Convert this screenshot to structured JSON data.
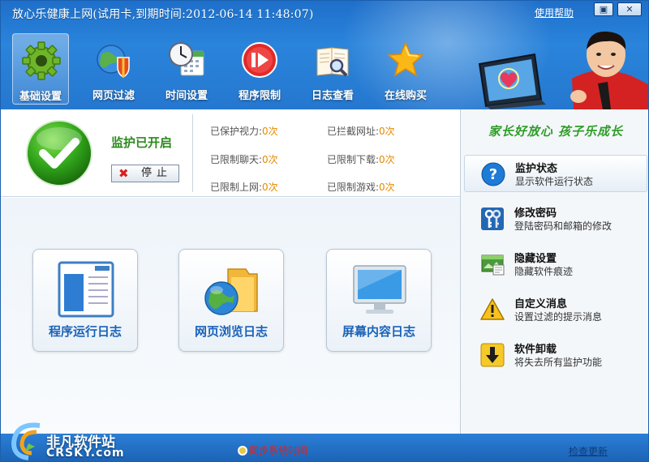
{
  "window": {
    "title": "放心乐健康上网(试用卡,到期时间:2012-06-14 11:48:07)",
    "help": "使用帮助",
    "min_symbol": "▣",
    "close_symbol": "✕"
  },
  "toolbar": [
    {
      "label": "基础设置",
      "icon": "gear-icon",
      "active": true
    },
    {
      "label": "网页过滤",
      "icon": "globe-shield-icon"
    },
    {
      "label": "时间设置",
      "icon": "clock-calendar-icon"
    },
    {
      "label": "程序限制",
      "icon": "stop-program-icon"
    },
    {
      "label": "日志查看",
      "icon": "log-search-icon"
    },
    {
      "label": "在线购买",
      "icon": "star-icon"
    }
  ],
  "status": {
    "title": "监护已开启",
    "stop_label": "停止",
    "stop_symbol": "✖",
    "stats": [
      {
        "label": "已保护视力:",
        "value": "0次"
      },
      {
        "label": "已拦截网址:",
        "value": "0次"
      },
      {
        "label": "已限制聊天:",
        "value": "0次"
      },
      {
        "label": "已限制下载:",
        "value": "0次"
      },
      {
        "label": "已限制上网:",
        "value": "0次"
      },
      {
        "label": "已限制游戏:",
        "value": "0次"
      }
    ]
  },
  "cards": [
    {
      "label": "程序运行日志",
      "icon": "program-log-icon"
    },
    {
      "label": "网页浏览日志",
      "icon": "web-log-icon"
    },
    {
      "label": "屏幕内容日志",
      "icon": "screen-log-icon"
    }
  ],
  "side": {
    "slogan": "家长好放心 孩子乐成长",
    "items": [
      {
        "title": "监护状态",
        "sub": "显示软件运行状态",
        "icon": "help-circle-icon",
        "active": true
      },
      {
        "title": "修改密码",
        "sub": "登陆密码和邮箱的修改",
        "icon": "keys-icon"
      },
      {
        "title": "隐藏设置",
        "sub": "隐藏软件痕迹",
        "icon": "hidden-window-icon"
      },
      {
        "title": "自定义消息",
        "sub": "设置过滤的提示消息",
        "icon": "warning-icon"
      },
      {
        "title": "软件卸载",
        "sub": "将失去所有监护功能",
        "icon": "download-arrow-icon"
      }
    ]
  },
  "footer": {
    "logo_cn": "非凡软件站",
    "logo_en": "CRSKY.com",
    "sync": "同步系统时间",
    "check_update": "检查更新"
  },
  "colors": {
    "header_blue": "#2577cf",
    "status_green": "#2b8a1c",
    "count_orange": "#e68a00",
    "card_text_blue": "#1a62b8",
    "sync_red": "#e0201c"
  }
}
